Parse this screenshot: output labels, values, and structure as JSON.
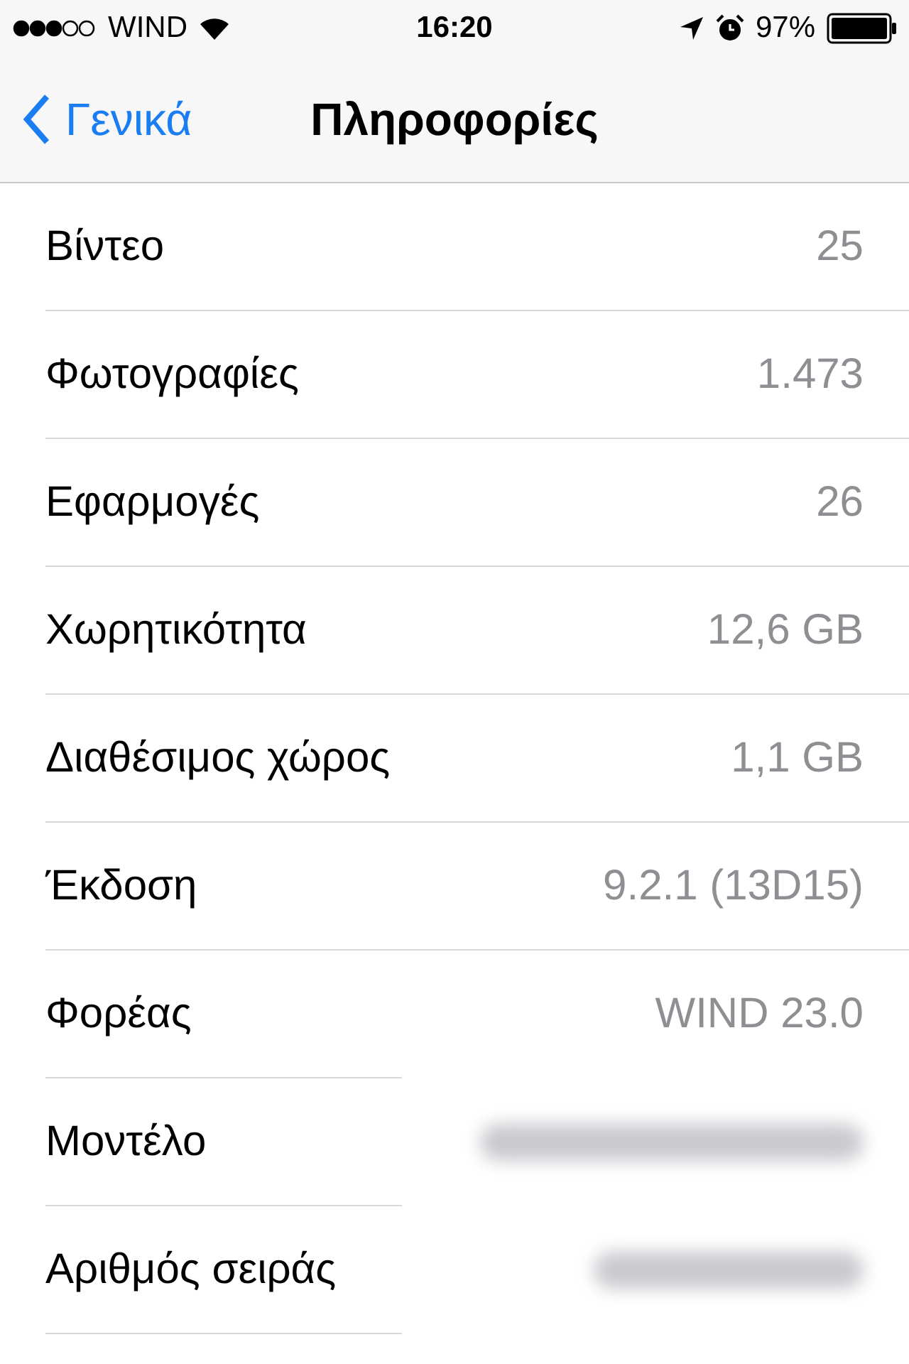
{
  "status_bar": {
    "carrier": "WIND",
    "time": "16:20",
    "battery": "97%"
  },
  "nav": {
    "back": "Γενικά",
    "title": "Πληροφορίες"
  },
  "rows": [
    {
      "label": "Βίντεο",
      "kind": "text",
      "value": "25"
    },
    {
      "label": "Φωτογραφίες",
      "kind": "text",
      "value": "1.473"
    },
    {
      "label": "Εφαρμογές",
      "kind": "text",
      "value": "26"
    },
    {
      "label": "Χωρητικότητα",
      "kind": "text",
      "value": "12,6 GB"
    },
    {
      "label": "Διαθέσιμος χώρος",
      "kind": "text",
      "value": "1,1 GB"
    },
    {
      "label": "Έκδοση",
      "kind": "text",
      "value": "9.2.1 (13D15)"
    },
    {
      "label": "Φορέας",
      "kind": "text",
      "value": "WIND 23.0"
    },
    {
      "label": "Μοντέλο",
      "kind": "blurred"
    },
    {
      "label": "Αριθμός σειράς",
      "kind": "blurred"
    }
  ]
}
